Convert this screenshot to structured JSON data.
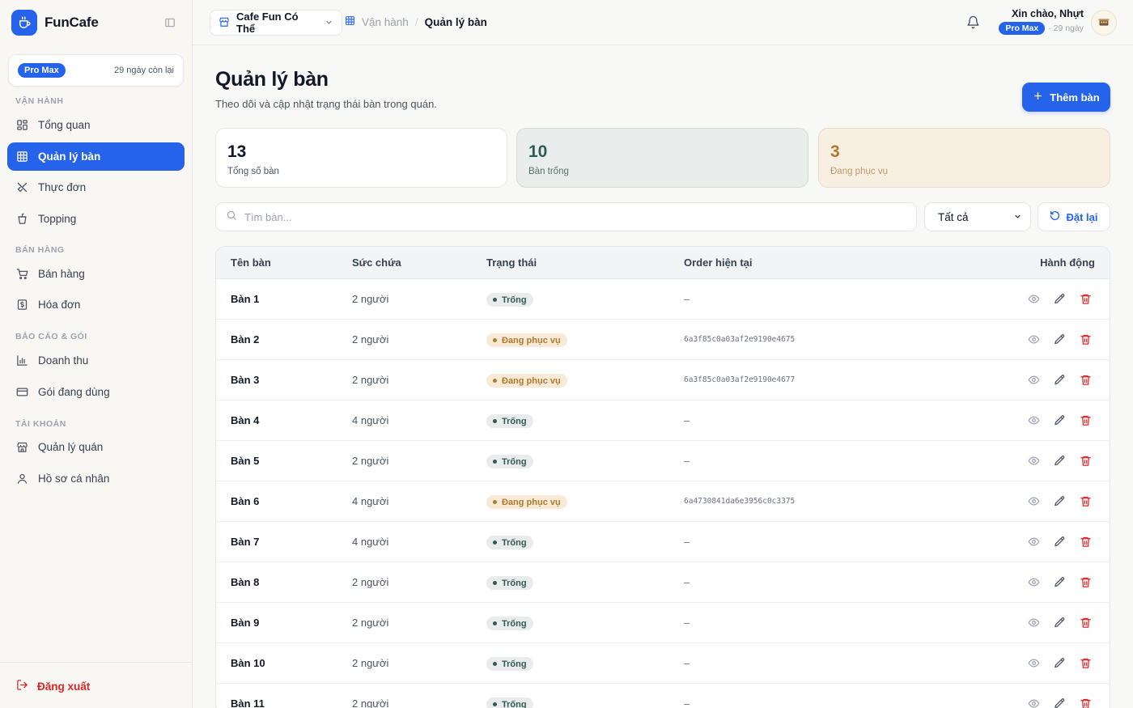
{
  "brand": {
    "name": "FunCafe"
  },
  "plan": {
    "badge": "Pro Max",
    "days_left": "29 ngày còn lại"
  },
  "nav": {
    "sections": [
      {
        "title": "VẬN HÀNH"
      },
      {
        "title": "BÁN HÀNG"
      },
      {
        "title": "BÁO CÁO & GÓI"
      },
      {
        "title": "TÀI KHOẢN"
      }
    ],
    "items": [
      {
        "label": "Tổng quan",
        "icon": "dashboard-icon"
      },
      {
        "label": "Quản lý bàn",
        "icon": "grid-icon",
        "active": true
      },
      {
        "label": "Thực đơn",
        "icon": "utensils-icon"
      },
      {
        "label": "Topping",
        "icon": "cup-icon"
      },
      {
        "label": "Bán hàng",
        "icon": "cart-icon"
      },
      {
        "label": "Hóa đơn",
        "icon": "receipt-icon"
      },
      {
        "label": "Doanh thu",
        "icon": "bar-chart-icon"
      },
      {
        "label": "Gói đang dùng",
        "icon": "credit-card-icon"
      },
      {
        "label": "Quản lý quán",
        "icon": "store-icon"
      },
      {
        "label": "Hồ sơ cá nhân",
        "icon": "user-icon"
      }
    ],
    "logout": "Đăng xuất"
  },
  "topbar": {
    "store": "Cafe Fun Có Thể",
    "breadcrumb": {
      "parent": "Vận hành",
      "separator": "/",
      "current": "Quản lý bàn"
    },
    "greeting": "Xin chào, Nhựt",
    "plan_badge": "Pro Max",
    "plan_days": "· 29 ngày"
  },
  "page": {
    "title": "Quản lý bàn",
    "subtitle": "Theo dõi và cập nhật trạng thái bàn trong quán.",
    "add_button": "Thêm bàn"
  },
  "stats": [
    {
      "value": "13",
      "label": "Tổng số bàn"
    },
    {
      "value": "10",
      "label": "Bàn trống"
    },
    {
      "value": "3",
      "label": "Đang phục vụ"
    }
  ],
  "filters": {
    "search_placeholder": "Tìm bàn...",
    "status_selected": "Tất cả",
    "reset": "Đặt lại"
  },
  "table": {
    "headers": {
      "name": "Tên bàn",
      "capacity": "Sức chứa",
      "status": "Trạng thái",
      "order": "Order hiện tại",
      "actions": "Hành động"
    },
    "rows": [
      {
        "name": "Bàn 1",
        "capacity": "2 người",
        "status": "Trống",
        "order": "–"
      },
      {
        "name": "Bàn 2",
        "capacity": "2 người",
        "status": "Đang phục vụ",
        "order": "6a3f85c0a03af2e9190e4675"
      },
      {
        "name": "Bàn 3",
        "capacity": "2 người",
        "status": "Đang phục vụ",
        "order": "6a3f85c0a03af2e9190e4677"
      },
      {
        "name": "Bàn 4",
        "capacity": "4 người",
        "status": "Trống",
        "order": "–"
      },
      {
        "name": "Bàn 5",
        "capacity": "2 người",
        "status": "Trống",
        "order": "–"
      },
      {
        "name": "Bàn 6",
        "capacity": "4 người",
        "status": "Đang phục vụ",
        "order": "6a4730841da6e3956c0c3375"
      },
      {
        "name": "Bàn 7",
        "capacity": "4 người",
        "status": "Trống",
        "order": "–"
      },
      {
        "name": "Bàn 8",
        "capacity": "2 người",
        "status": "Trống",
        "order": "–"
      },
      {
        "name": "Bàn 9",
        "capacity": "2 người",
        "status": "Trống",
        "order": "–"
      },
      {
        "name": "Bàn 10",
        "capacity": "2 người",
        "status": "Trống",
        "order": "–"
      },
      {
        "name": "Bàn 11",
        "capacity": "2 người",
        "status": "Trống",
        "order": "–"
      }
    ]
  },
  "colors": {
    "accent": "#2563eb",
    "free": "#2f5c52",
    "busy": "#b07a2e",
    "danger": "#dc2626"
  }
}
